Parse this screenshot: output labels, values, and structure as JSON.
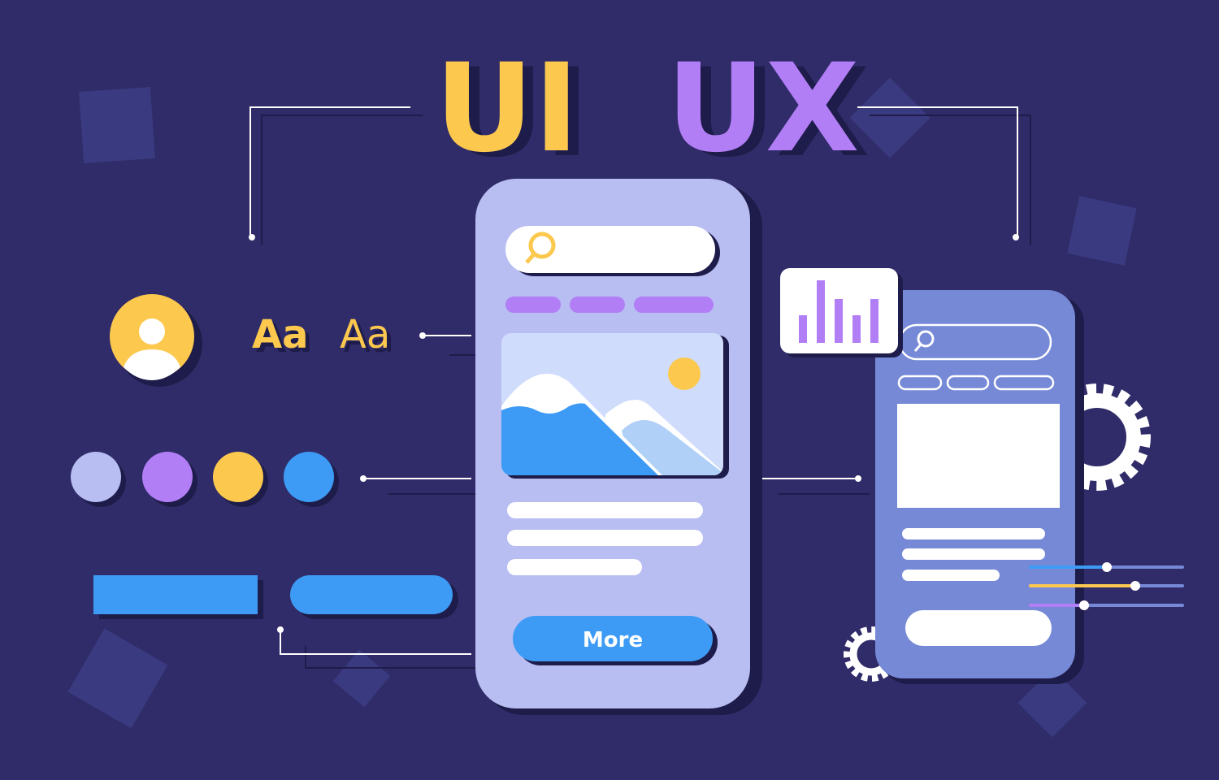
{
  "title": {
    "ui": "UI",
    "ux": "UX"
  },
  "typography": {
    "sample_1": "Aa",
    "sample_2": "Aa"
  },
  "main_phone": {
    "button_label": "More"
  },
  "colors": {
    "background": "#302c69",
    "yellow": "#fcc94e",
    "purple": "#b27ef5",
    "blue": "#3d9bf5",
    "lavender": "#b8bdf2",
    "phone_secondary": "#7689d6"
  },
  "icons": [
    "search-icon",
    "user-avatar-icon",
    "bar-chart-icon",
    "gear-icon",
    "image-icon"
  ]
}
